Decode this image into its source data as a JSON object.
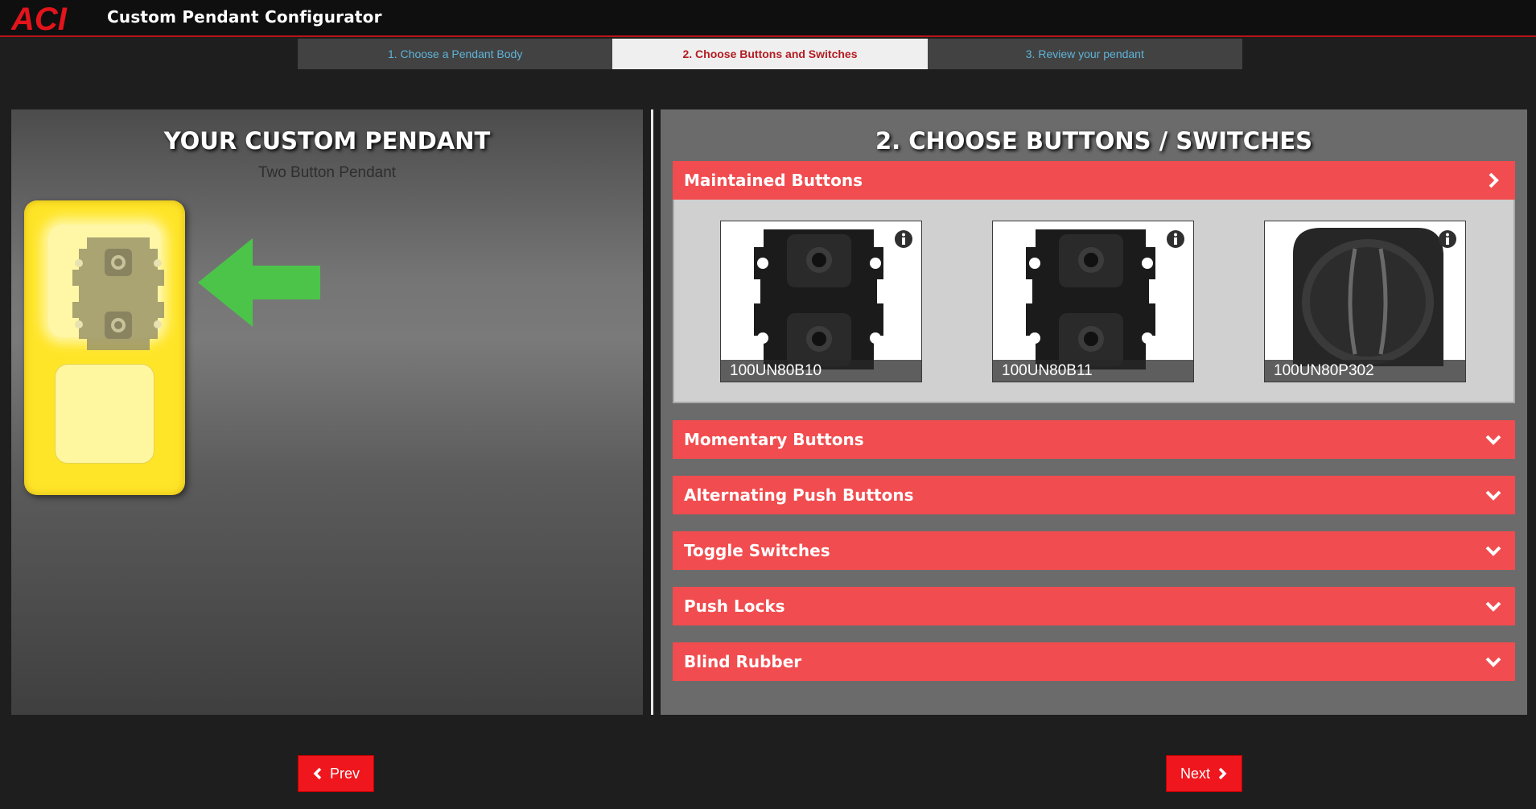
{
  "header": {
    "logo_text": "ACI",
    "title": "Custom Pendant Configurator"
  },
  "steps": [
    {
      "label": "1. Choose a Pendant Body",
      "active": false
    },
    {
      "label": "2. Choose Buttons and Switches",
      "active": true
    },
    {
      "label": "3. Review your pendant",
      "active": false
    }
  ],
  "left": {
    "title": "YOUR CUSTOM PENDANT",
    "subtitle": "Two Button Pendant"
  },
  "right": {
    "title": "2. CHOOSE BUTTONS / SWITCHES",
    "sections": [
      {
        "label": "Maintained Buttons",
        "expanded": true,
        "icon": "chevron-right-icon"
      },
      {
        "label": "Momentary Buttons",
        "expanded": false,
        "icon": "chevron-down-icon"
      },
      {
        "label": "Alternating Push Buttons",
        "expanded": false,
        "icon": "chevron-down-icon"
      },
      {
        "label": "Toggle Switches",
        "expanded": false,
        "icon": "chevron-down-icon"
      },
      {
        "label": "Push Locks",
        "expanded": false,
        "icon": "chevron-down-icon"
      },
      {
        "label": "Blind Rubber",
        "expanded": false,
        "icon": "chevron-down-icon"
      }
    ],
    "products": [
      {
        "code": "100UN80B10"
      },
      {
        "code": "100UN80B11"
      },
      {
        "code": "100UN80P302"
      }
    ]
  },
  "nav": {
    "prev_label": "Prev",
    "next_label": "Next"
  },
  "colors": {
    "accent_red": "#f14c4f",
    "button_red": "#f0161d",
    "pendant_yellow": "#ffe528",
    "arrow_green": "#4cc44a",
    "step_link": "#5fb4d8"
  }
}
